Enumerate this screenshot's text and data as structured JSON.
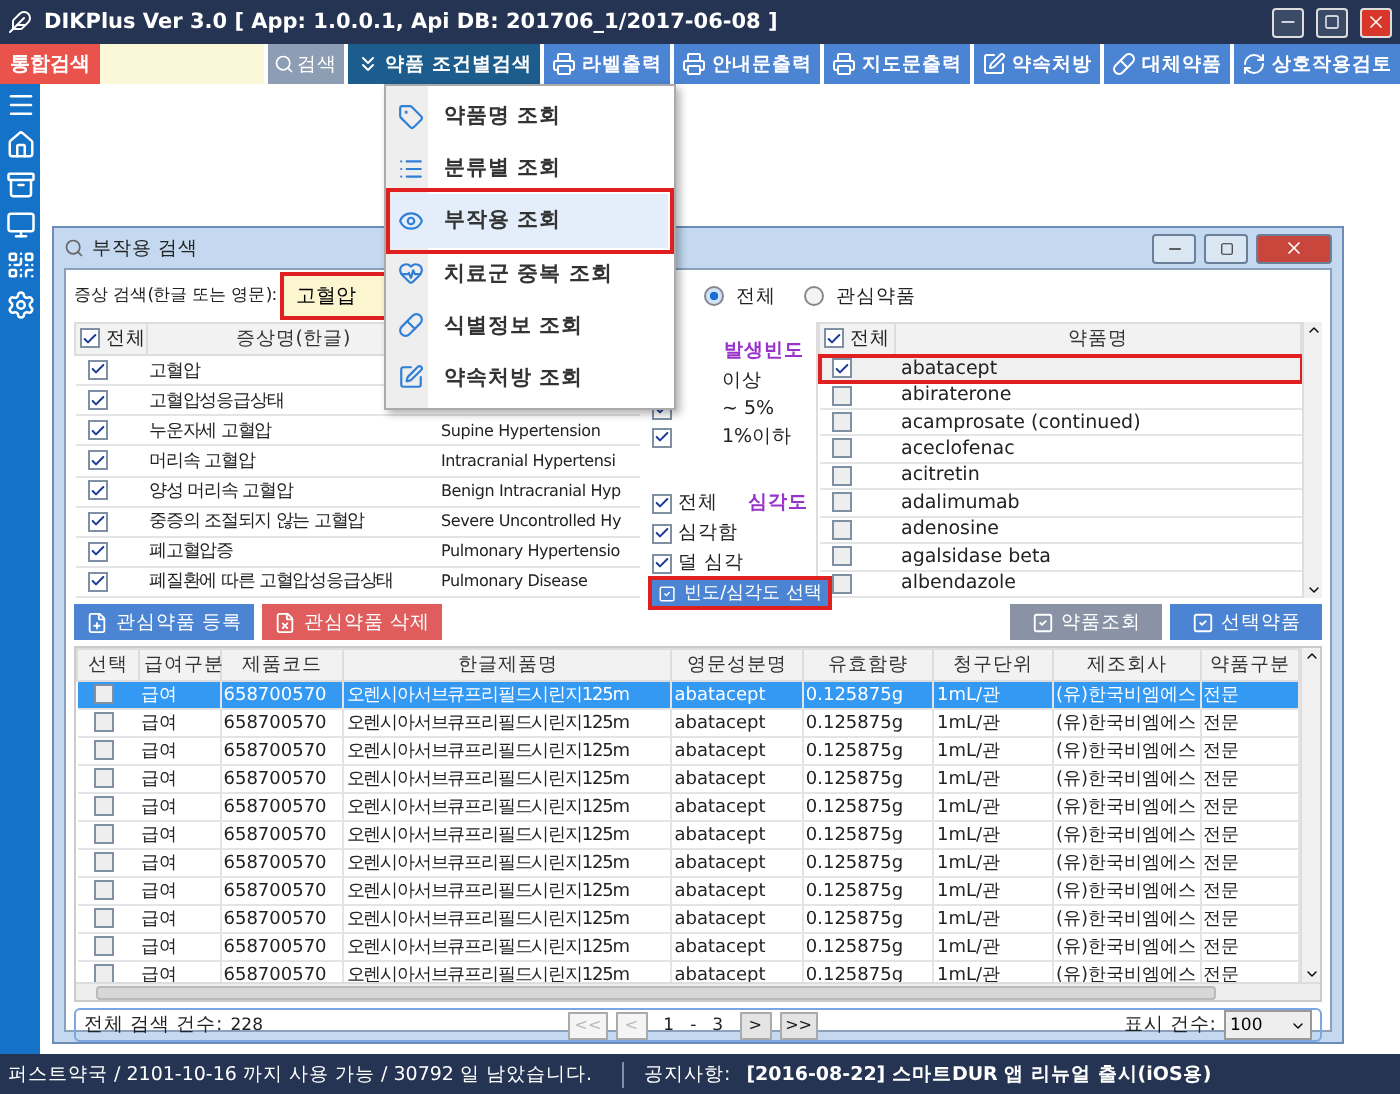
{
  "window": {
    "title": "DIKPlus Ver 3.0 [ App: 1.0.0.1, Api DB: 201706_1/2017-06-08 ]"
  },
  "toolbar": {
    "integrated_search": "통합검색",
    "search_button": "검색",
    "buttons": [
      {
        "label": "약품 조건별검색",
        "selected": true
      },
      {
        "label": "라벨출력",
        "selected": false
      },
      {
        "label": "안내문출력",
        "selected": false
      },
      {
        "label": "지도문출력",
        "selected": false
      },
      {
        "label": "약속처방",
        "selected": false
      },
      {
        "label": "대체약품",
        "selected": false
      },
      {
        "label": "상호작용검토",
        "selected": false
      }
    ]
  },
  "menu": {
    "items": [
      {
        "label": "약품명 조회",
        "selected": false
      },
      {
        "label": "분류별 조회",
        "selected": false
      },
      {
        "label": "부작용 조회",
        "selected": true
      },
      {
        "label": "치료군 중복 조회",
        "selected": false
      },
      {
        "label": "식별정보 조회",
        "selected": false
      },
      {
        "label": "약속처방 조회",
        "selected": false
      }
    ]
  },
  "dialog": {
    "title": "부작용 검색",
    "search_label": "증상 검색(한글 또는 영문):",
    "search_value": "고혈압",
    "search_highlighted": true,
    "scope_options": [
      {
        "label": "전체",
        "selected": true
      },
      {
        "label": "관심약품",
        "selected": false
      }
    ],
    "symptoms": {
      "all_label": "전체",
      "all_checked": true,
      "column": "증상명(한글)",
      "rows": [
        {
          "name": "고혈압",
          "english": "",
          "checked": true
        },
        {
          "name": "고혈압성응급상태",
          "english": "",
          "checked": true
        },
        {
          "name": "누운자세 고혈압",
          "english": "Supine Hypertension",
          "checked": true
        },
        {
          "name": "머리속 고혈압",
          "english": "Intracranial Hypertensi",
          "checked": true
        },
        {
          "name": "양성 머리속 고혈압",
          "english": "Benign Intracranial Hyp",
          "checked": true
        },
        {
          "name": "중증의 조절되지 않는 고혈압",
          "english": "Severe Uncontrolled Hy",
          "checked": true
        },
        {
          "name": "폐고혈압증",
          "english": "Pulmonary Hypertensio",
          "checked": true
        },
        {
          "name": "폐질환에 따른 고혈압성응급상태",
          "english": "Pulmonary Disease",
          "checked": true
        }
      ]
    },
    "frequency": {
      "title": "발생빈도",
      "options": [
        {
          "label": "이상"
        },
        {
          "label": "~ 5%",
          "checked": true
        },
        {
          "label": "1%이하",
          "checked": true
        }
      ]
    },
    "severity": {
      "all_label": "전체",
      "all_checked": true,
      "title": "심각도",
      "options": [
        {
          "label": "심각함",
          "checked": true
        },
        {
          "label": "덜 심각",
          "checked": true
        }
      ]
    },
    "apply_button": {
      "label": "빈도/심각도 선택",
      "highlighted": true
    },
    "drugs": {
      "all_label": "전체",
      "all_checked": true,
      "column": "약품명",
      "rows": [
        {
          "name": "abatacept",
          "checked": true,
          "selected": true
        },
        {
          "name": "abiraterone",
          "checked": false,
          "selected": false
        },
        {
          "name": "acamprosate (continued)",
          "checked": false,
          "selected": false
        },
        {
          "name": "aceclofenac",
          "checked": false,
          "selected": false
        },
        {
          "name": "acitretin",
          "checked": false,
          "selected": false
        },
        {
          "name": "adalimumab",
          "checked": false,
          "selected": false
        },
        {
          "name": "adenosine",
          "checked": false,
          "selected": false
        },
        {
          "name": "agalsidase beta",
          "checked": false,
          "selected": false
        },
        {
          "name": "albendazole",
          "checked": false,
          "selected": false
        }
      ]
    },
    "left_buttons": [
      {
        "label": "관심약품 등록",
        "kind": "add"
      },
      {
        "label": "관심약품 삭제",
        "kind": "delete"
      }
    ],
    "right_buttons": [
      {
        "label": "약품조회",
        "disabled": true
      },
      {
        "label": "선택약품",
        "disabled": false
      }
    ],
    "products": {
      "selection_column": "선택",
      "columns": [
        "급여구분",
        "제품코드",
        "한글제품명",
        "영문성분명",
        "유효함량",
        "청구단위",
        "제조회사",
        "약품구분"
      ],
      "rows": [
        {
          "checked": false,
          "selected": true,
          "cells": [
            "급여",
            "658700570",
            "오렌시아서브큐프리필드시린지125m",
            "abatacept",
            "0.125875g",
            "1mL/관",
            "(유)한국비엠에스",
            "전문"
          ]
        },
        {
          "checked": false,
          "selected": false,
          "cells": [
            "급여",
            "658700570",
            "오렌시아서브큐프리필드시린지125m",
            "abatacept",
            "0.125875g",
            "1mL/관",
            "(유)한국비엠에스",
            "전문"
          ]
        },
        {
          "checked": false,
          "selected": false,
          "cells": [
            "급여",
            "658700570",
            "오렌시아서브큐프리필드시린지125m",
            "abatacept",
            "0.125875g",
            "1mL/관",
            "(유)한국비엠에스",
            "전문"
          ]
        },
        {
          "checked": false,
          "selected": false,
          "cells": [
            "급여",
            "658700570",
            "오렌시아서브큐프리필드시린지125m",
            "abatacept",
            "0.125875g",
            "1mL/관",
            "(유)한국비엠에스",
            "전문"
          ]
        },
        {
          "checked": false,
          "selected": false,
          "cells": [
            "급여",
            "658700570",
            "오렌시아서브큐프리필드시린지125m",
            "abatacept",
            "0.125875g",
            "1mL/관",
            "(유)한국비엠에스",
            "전문"
          ]
        },
        {
          "checked": false,
          "selected": false,
          "cells": [
            "급여",
            "658700570",
            "오렌시아서브큐프리필드시린지125m",
            "abatacept",
            "0.125875g",
            "1mL/관",
            "(유)한국비엠에스",
            "전문"
          ]
        },
        {
          "checked": false,
          "selected": false,
          "cells": [
            "급여",
            "658700570",
            "오렌시아서브큐프리필드시린지125m",
            "abatacept",
            "0.125875g",
            "1mL/관",
            "(유)한국비엠에스",
            "전문"
          ]
        },
        {
          "checked": false,
          "selected": false,
          "cells": [
            "급여",
            "658700570",
            "오렌시아서브큐프리필드시린지125m",
            "abatacept",
            "0.125875g",
            "1mL/관",
            "(유)한국비엠에스",
            "전문"
          ]
        },
        {
          "checked": false,
          "selected": false,
          "cells": [
            "급여",
            "658700570",
            "오렌시아서브큐프리필드시린지125m",
            "abatacept",
            "0.125875g",
            "1mL/관",
            "(유)한국비엠에스",
            "전문"
          ]
        },
        {
          "checked": false,
          "selected": false,
          "cells": [
            "급여",
            "658700570",
            "오렌시아서브큐프리필드시린지125m",
            "abatacept",
            "0.125875g",
            "1mL/관",
            "(유)한국비엠에스",
            "전문"
          ]
        },
        {
          "checked": false,
          "selected": false,
          "cells": [
            "급여",
            "658700570",
            "오렌시아서브큐프리필드시린지125m",
            "abatacept",
            "0.125875g",
            "1mL/관",
            "(유)한국비엠에스",
            "전문"
          ]
        }
      ]
    },
    "footer": {
      "total_label": "전체 검색 건수:",
      "total": "228",
      "first": "<<",
      "prev": "<",
      "page": "1",
      "separator": "-",
      "pages": "3",
      "next": ">",
      "last": ">>",
      "page_size_label": "표시 건수:",
      "page_size": "100"
    }
  },
  "status_bar": {
    "left": "퍼스트약국 / 2101-10-16 까지 사용 가능 / 30792 일 남았습니다.",
    "notice_label": "공지사항:",
    "notice": "[2016-08-22] 스마트DUR 앱 리뉴얼 출시(iOS용)"
  }
}
